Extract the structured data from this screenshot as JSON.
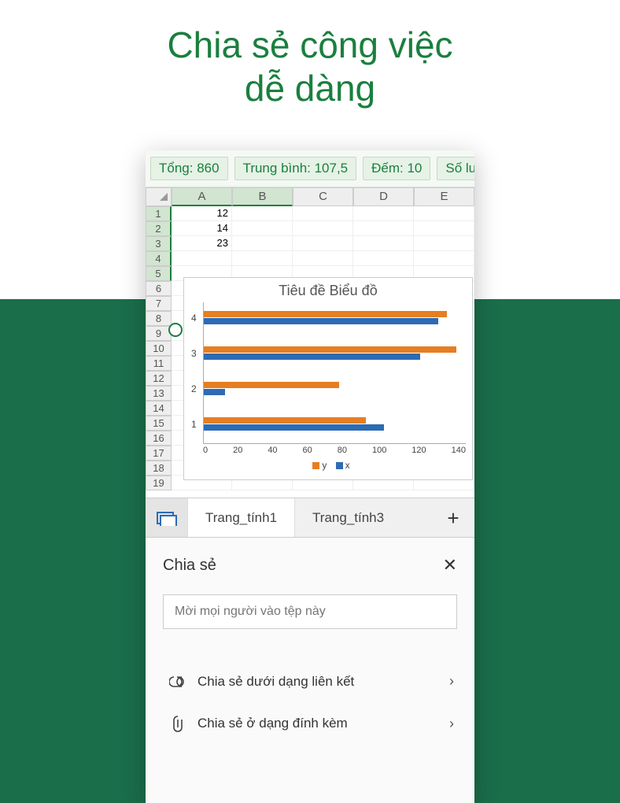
{
  "headline_line1": "Chia sẻ công việc",
  "headline_line2": "dễ dàng",
  "stats": {
    "sum": "Tổng: 860",
    "avg": "Trung bình: 107,5",
    "count": "Đếm: 10",
    "more": "Số lư"
  },
  "columns": [
    "A",
    "B",
    "C",
    "D",
    "E"
  ],
  "selected_columns": [
    "A",
    "B"
  ],
  "rows": [
    1,
    2,
    3,
    4,
    5,
    6,
    7,
    8,
    9,
    10,
    11,
    12,
    13,
    14,
    15,
    16,
    17,
    18,
    19
  ],
  "cells": {
    "A1": "12",
    "A2": "14",
    "A3": "23"
  },
  "chart_data": {
    "type": "bar",
    "orientation": "horizontal",
    "title": "Tiêu đề Biểu đồ",
    "categories": [
      "1",
      "2",
      "3",
      "4"
    ],
    "series": [
      {
        "name": "y",
        "color": "#e67e22",
        "values": [
          90,
          75,
          140,
          135
        ]
      },
      {
        "name": "x",
        "color": "#2d6bb5",
        "values": [
          100,
          12,
          120,
          130
        ]
      }
    ],
    "xticks": [
      0,
      20,
      40,
      60,
      80,
      100,
      120,
      140
    ],
    "xlim": [
      0,
      145
    ]
  },
  "sheet_tabs": {
    "tab1": "Trang_tính1",
    "tab2": "Trang_tính3"
  },
  "share": {
    "title": "Chia sẻ",
    "invite_placeholder": "Mời mọi người vào tệp này",
    "as_link": "Chia sẻ dưới dạng liên kết",
    "as_attachment": "Chia sẻ ở dạng đính kèm"
  }
}
